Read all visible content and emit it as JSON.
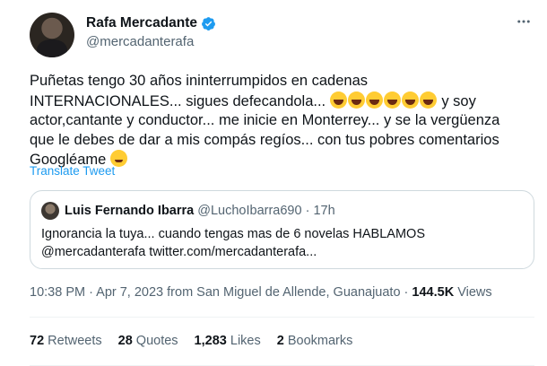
{
  "author": {
    "display_name": "Rafa Mercadante",
    "handle": "@mercadanterafa",
    "verified_icon": "verified-badge-icon",
    "accent": "#1d9bf0"
  },
  "tweet": {
    "lines": [
      "Puñetas tengo 30 años ininterrumpidos en cadenas",
      "INTERNACIONALES... sigues defecandola...",
      "y soy",
      "actor,cantante y conductor... me inicie en Monterrey... y se la vergüenza",
      "que le debes de dar a mis compás regíos... con tus pobres comentarios",
      "Googléame"
    ],
    "laugh_emoji_count": 6,
    "translate_label": "Translate Tweet"
  },
  "quoted": {
    "name": "Luis Fernando Ibarra",
    "handle": "@LuchoIbarra690",
    "separator": "·",
    "time": "17h",
    "lines": [
      "Ignorancia la tuya... cuando tengas mas de 6 novelas HABLAMOS",
      "@mercadanterafa twitter.com/mercadanterafa..."
    ]
  },
  "meta": {
    "timestamp": "10:38 PM · Apr 7, 2023 from San Miguel de Allende, Guanajuato · ",
    "views_count": "144.5K",
    "views_label": " Views"
  },
  "stats": [
    {
      "count": "72",
      "label": "Retweets"
    },
    {
      "count": "28",
      "label": "Quotes"
    },
    {
      "count": "1,283",
      "label": "Likes"
    },
    {
      "count": "2",
      "label": "Bookmarks"
    }
  ],
  "more_icon": "more-options-icon"
}
